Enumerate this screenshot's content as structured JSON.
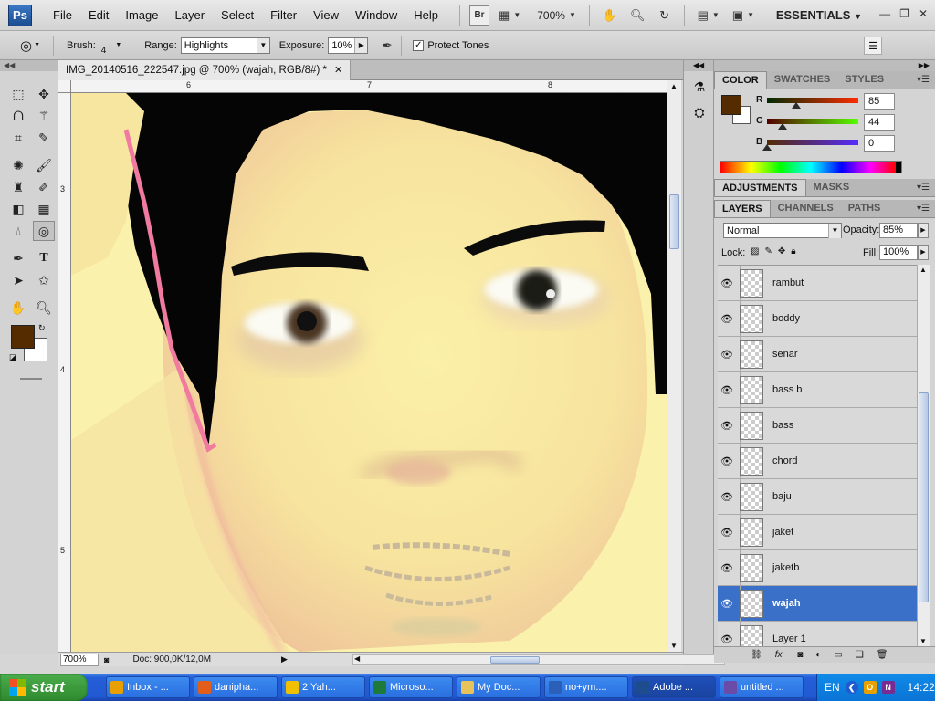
{
  "app": {
    "logo": "Ps",
    "menu": [
      "File",
      "Edit",
      "Image",
      "Layer",
      "Select",
      "Filter",
      "View",
      "Window",
      "Help"
    ],
    "bridge_label": "Br",
    "zoom_level": "700%",
    "workspace": "ESSENTIALS"
  },
  "options": {
    "brush_label": "Brush:",
    "brush_size": "4",
    "range_label": "Range:",
    "range_value": "Highlights",
    "exposure_label": "Exposure:",
    "exposure_value": "10%",
    "protect_tones_label": "Protect Tones",
    "protect_tones_checked": true
  },
  "document": {
    "tab_title": "IMG_20140516_222547.jpg @ 700% (wajah, RGB/8#) *",
    "ruler_top": [
      "6",
      "7",
      "8"
    ],
    "ruler_left": [
      "3",
      "4",
      "5"
    ],
    "status_zoom": "700%",
    "status_info": "Doc: 900,0K/12,0M"
  },
  "color_panel": {
    "tabs": [
      "COLOR",
      "SWATCHES",
      "STYLES"
    ],
    "active_tab": "COLOR",
    "r_label": "R",
    "g_label": "G",
    "b_label": "B",
    "r": "85",
    "g": "44",
    "b": "0",
    "foreground": "#552c00",
    "background": "#ffffff"
  },
  "adjustments_panel": {
    "tabs": [
      "ADJUSTMENTS",
      "MASKS"
    ]
  },
  "layers_panel": {
    "tabs": [
      "LAYERS",
      "CHANNELS",
      "PATHS"
    ],
    "blend_mode": "Normal",
    "opacity_label": "Opacity:",
    "opacity": "85%",
    "lock_label": "Lock:",
    "fill_label": "Fill:",
    "fill": "100%",
    "layers": [
      {
        "name": "rambut",
        "selected": false
      },
      {
        "name": "boddy",
        "selected": false
      },
      {
        "name": "senar",
        "selected": false
      },
      {
        "name": "bass b",
        "selected": false
      },
      {
        "name": "bass",
        "selected": false
      },
      {
        "name": "chord",
        "selected": false
      },
      {
        "name": "baju",
        "selected": false
      },
      {
        "name": "jaket",
        "selected": false
      },
      {
        "name": "jaketb",
        "selected": false
      },
      {
        "name": "wajah",
        "selected": true
      },
      {
        "name": "Layer 1",
        "selected": false
      }
    ]
  },
  "taskbar": {
    "start_label": "start",
    "tasks": [
      {
        "label": "Inbox - ...",
        "icon": "outlook-icon",
        "color": "#e8a000"
      },
      {
        "label": "danipha...",
        "icon": "firefox-icon",
        "color": "#e35d1a"
      },
      {
        "label": "2 Yah...",
        "icon": "messenger-icon",
        "color": "#f0c000"
      },
      {
        "label": "Microso...",
        "icon": "excel-icon",
        "color": "#1d7a3a"
      },
      {
        "label": "My Doc...",
        "icon": "folder-icon",
        "color": "#e8c25a"
      },
      {
        "label": "no+ym....",
        "icon": "word-icon",
        "color": "#2b5fb8"
      },
      {
        "label": "Adobe ...",
        "icon": "photoshop-icon",
        "color": "#1d4d8f",
        "active": true
      },
      {
        "label": "untitled ...",
        "icon": "paint-icon",
        "color": "#6a4ca8"
      }
    ],
    "language": "EN",
    "clock": "14:22"
  }
}
